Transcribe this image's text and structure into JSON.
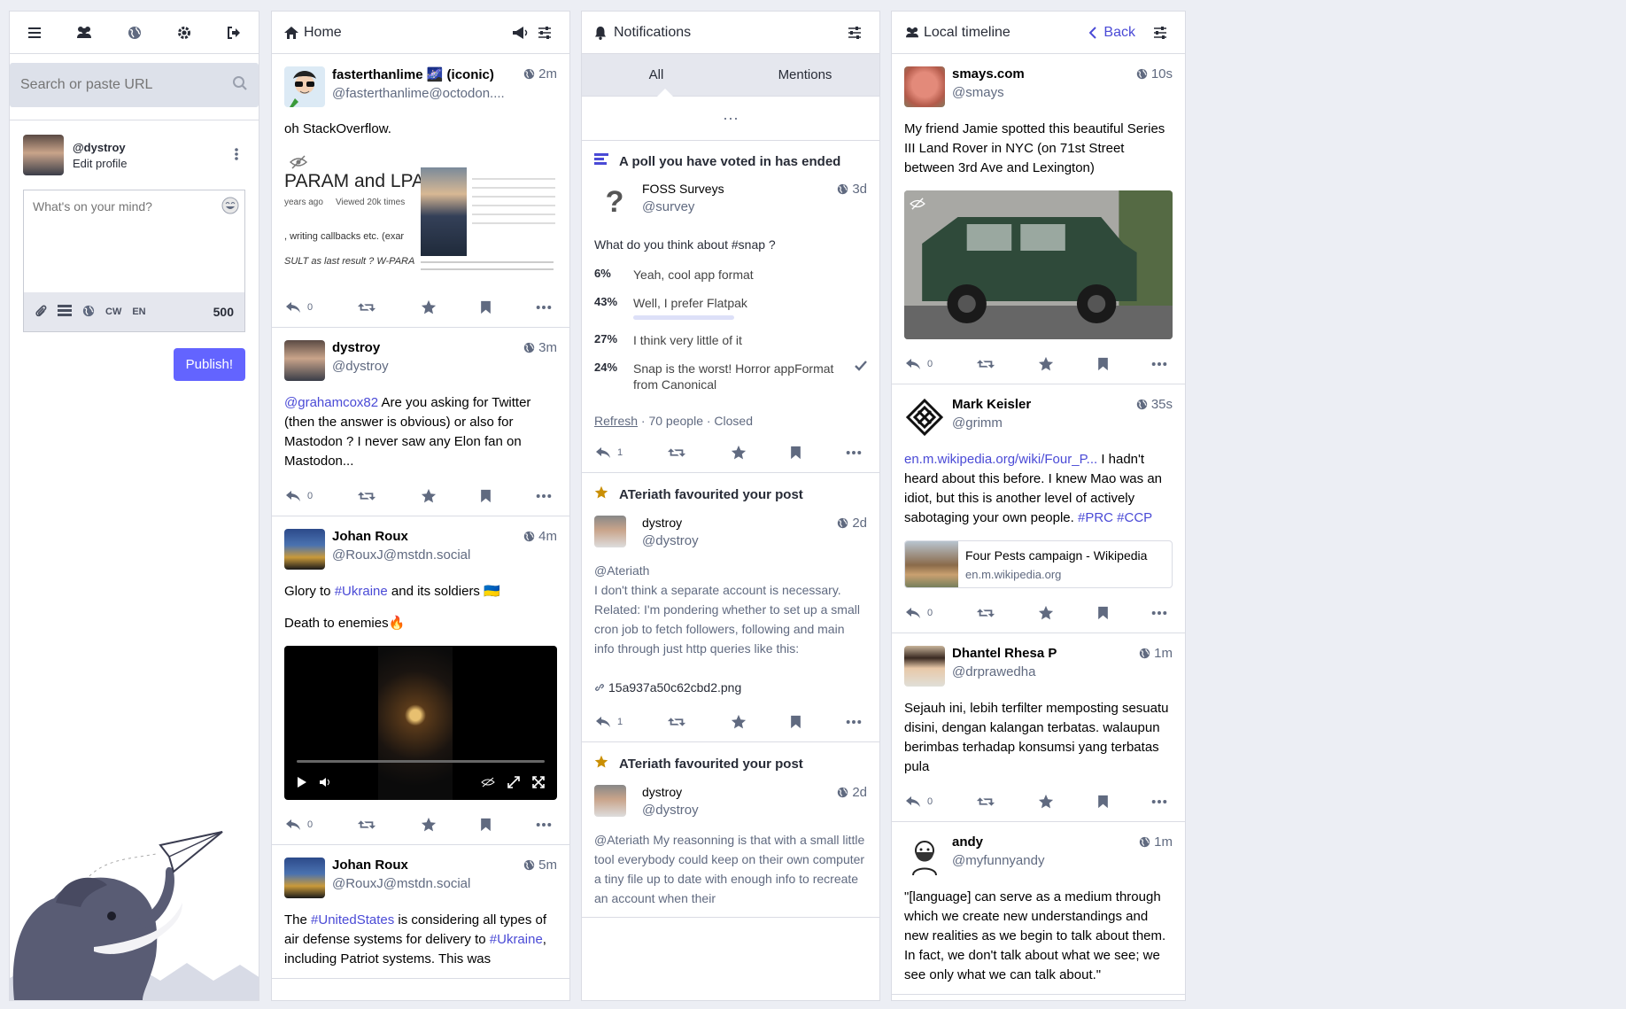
{
  "nav": {
    "search_placeholder": "Search or paste URL",
    "me_handle": "@dystroy",
    "edit_profile": "Edit profile",
    "compose_placeholder": "What's on your mind?",
    "cw_label": "CW",
    "lang_label": "EN",
    "char_count": "500",
    "publish_label": "Publish!"
  },
  "home": {
    "title": "Home",
    "statuses": [
      {
        "display": "fasterthanlime 🌌 (iconic)",
        "acct": "@fasterthanlime@octodon....",
        "time": "2m",
        "content": "oh StackOverflow.",
        "replies": "0",
        "image_text": "PARAM and LPA",
        "image_meta_1": "years ago",
        "image_meta_2": "Viewed 20k times",
        "image_line_1": ", writing callbacks etc. (exar",
        "image_line_2": "SULT as last result ? W-PARA"
      },
      {
        "display": "dystroy",
        "acct": "@dystroy",
        "time": "3m",
        "mention": "@grahamcox82",
        "content": " Are you asking for Twitter (then the answer is obvious) or also for Mastodon ? I never saw any Elon fan on Mastodon...",
        "replies": "0"
      },
      {
        "display": "Johan Roux",
        "acct": "@RouxJ@mstdn.social",
        "time": "4m",
        "content_a": "Glory to ",
        "tag": "#Ukraine",
        "content_b": " and its soldiers 🇺🇦",
        "content_c": "Death to enemies🔥",
        "replies": "0"
      },
      {
        "display": "Johan Roux",
        "acct": "@RouxJ@mstdn.social",
        "time": "5m",
        "content_a": "The ",
        "tag1": "#UnitedStates",
        "content_b": " is considering all types of air defense systems for delivery to ",
        "tag2": "#Ukraine",
        "content_c": ", including Patriot systems. This was"
      }
    ]
  },
  "notifications": {
    "title": "Notifications",
    "tab_all": "All",
    "tab_mentions": "Mentions",
    "load_more": "···",
    "poll": {
      "header": "A poll you have voted in has ended",
      "display": "FOSS Surveys",
      "acct": "@survey",
      "time": "3d",
      "question": "What do you think about #snap ?",
      "options": [
        {
          "pct": "6%",
          "label": "Yeah, cool app format",
          "value": 6
        },
        {
          "pct": "43%",
          "label": "Well, I prefer Flatpak",
          "value": 43
        },
        {
          "pct": "27%",
          "label": "I think very little of it",
          "value": 27
        },
        {
          "pct": "24%",
          "label": "Snap is the worst! Horror appFormat from Canonical",
          "value": 24
        }
      ],
      "refresh": "Refresh",
      "footer": " · 70 people · Closed",
      "replies": "1"
    },
    "fav1": {
      "header": "ATeriath favourited your post",
      "display": "dystroy",
      "acct": "@dystroy",
      "time": "2d",
      "mention": "@Ateriath",
      "content": "I don't think a separate account is necessary. Related: I'm pondering whether to set up a small cron job to fetch followers, following and main info through just http queries like this:",
      "attachment": "15a937a50c62cbd2.png",
      "replies": "1"
    },
    "fav2": {
      "header": "ATeriath favourited your post",
      "display": "dystroy",
      "acct": "@dystroy",
      "time": "2d",
      "mention": "@Ateriath",
      "content": " My reasonning is that with a small little tool  everybody could keep on their own computer a tiny file up to date with enough info to recreate an account when their"
    }
  },
  "local": {
    "title": "Local timeline",
    "back": "Back",
    "statuses": [
      {
        "display": "smays.com",
        "acct": "@smays",
        "time": "10s",
        "content": "My friend Jamie spotted this beautiful Series III Land Rover in NYC (on 71st Street between 3rd Ave and Lexington)",
        "replies": "0"
      },
      {
        "display": "Mark Keisler",
        "acct": "@grimm",
        "time": "35s",
        "link": "en.m.wikipedia.org/wiki/Four_P...",
        "content": " I hadn't heard about this before. I knew Mao was an idiot, but this is another level of actively sabotaging your own people. ",
        "tag1": "#PRC",
        "tag2": "#CCP",
        "card_title": "Four Pests campaign - Wikipedia",
        "card_host": "en.m.wikipedia.org",
        "replies": "0"
      },
      {
        "display": "Dhantel Rhesa P",
        "acct": "@drprawedha",
        "time": "1m",
        "content": "Sejauh ini, lebih terfilter memposting sesuatu disini, dengan kalangan terbatas. walaupun berimbas terhadap konsumsi yang terbatas pula",
        "replies": "0"
      },
      {
        "display": "andy",
        "acct": "@myfunnyandy",
        "time": "1m",
        "content": "\"[language] can serve as a medium through which we create new understandings and new realities as we begin to talk about them. In fact, we don't talk about what we see; we see only what we can talk about.\""
      }
    ]
  },
  "colors": {
    "accent": "#6364ff",
    "link": "#4a4ad6",
    "star": "#ca8f04",
    "icon": "#606a80"
  }
}
